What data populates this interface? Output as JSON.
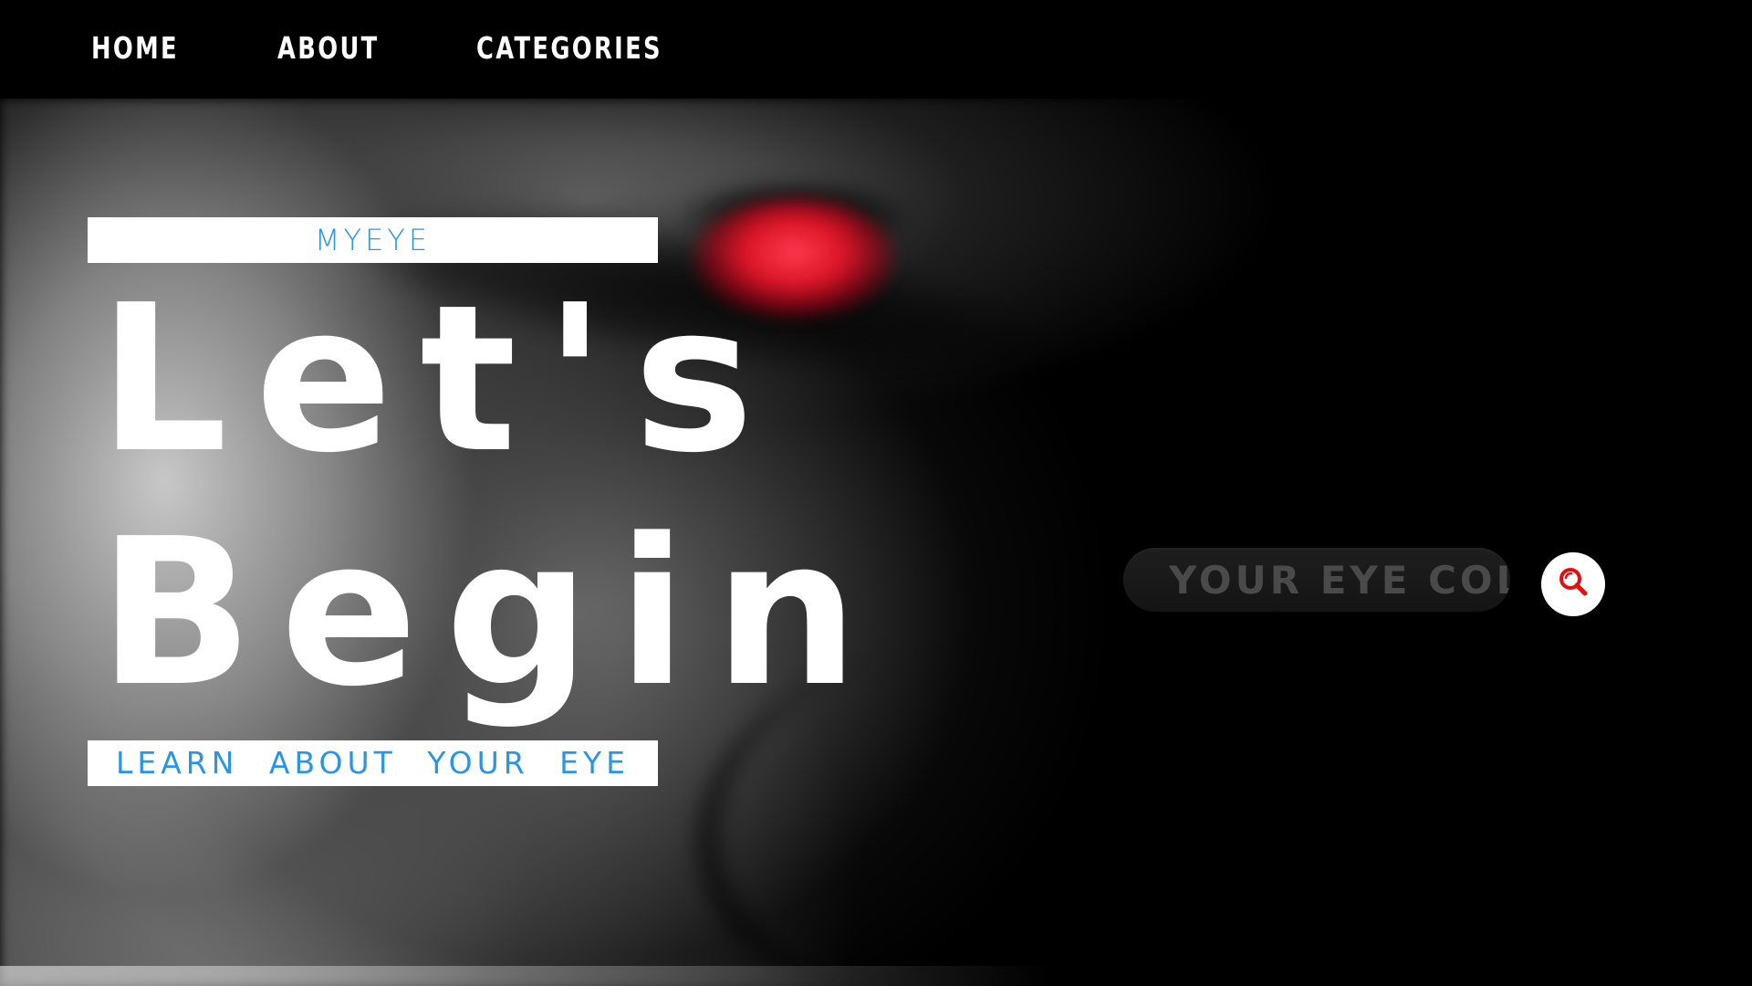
{
  "nav": {
    "home": "HOME",
    "about": "ABOUT",
    "categories": "CATEGORIES"
  },
  "hero": {
    "brand": "MYEYE",
    "headline_line1": "Let's",
    "headline_line2": "Begin",
    "tagline": "LEARN ABOUT YOUR EYE"
  },
  "search": {
    "placeholder": "YOUR EYE COLOR",
    "button_icon": "search-icon"
  },
  "colors": {
    "accent_blue": "#2b95e3",
    "icon_red": "#e01010",
    "nav_background": "#000000",
    "text_white": "#ffffff"
  }
}
